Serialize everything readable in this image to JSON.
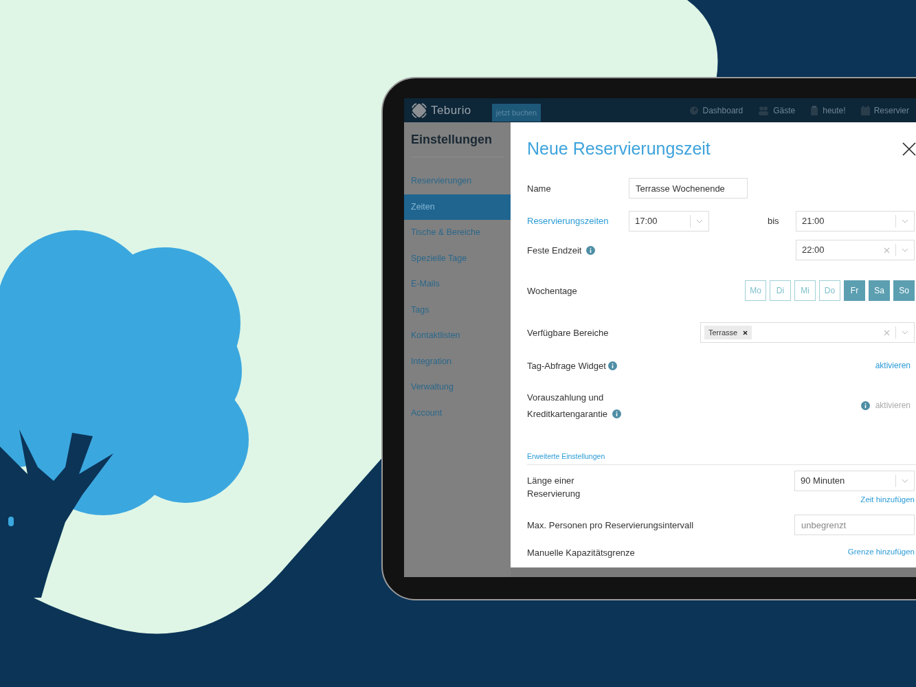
{
  "app_header": {
    "logo": "Teburio",
    "book_button": "jetzt buchen",
    "nav": [
      {
        "kind": "gauge",
        "label": "Dashboard"
      },
      {
        "kind": "people",
        "label": "Gäste"
      },
      {
        "kind": "clipboard",
        "label": "heute!"
      },
      {
        "kind": "calendar",
        "label": "Reservier"
      }
    ]
  },
  "sidebar": {
    "title": "Einstellungen",
    "items": [
      {
        "label": "Reservierungen",
        "selected": false
      },
      {
        "label": "Zeiten",
        "selected": true
      },
      {
        "label": "Tische & Bereiche",
        "selected": false
      },
      {
        "label": "Spezielle Tage",
        "selected": false
      },
      {
        "label": "E-Mails",
        "selected": false
      },
      {
        "label": "Tags",
        "selected": false
      },
      {
        "label": "Kontaktlisten",
        "selected": false
      },
      {
        "label": "Integration",
        "selected": false
      },
      {
        "label": "Verwaltung",
        "selected": false
      },
      {
        "label": "Account",
        "selected": false
      }
    ]
  },
  "modal": {
    "title": "Neue Reservierungszeit",
    "name": {
      "label": "Name",
      "value": "Terrasse Wochenende"
    },
    "times": {
      "label": "Reservierungszeiten",
      "from": "17:00",
      "separator": "bis",
      "to": "21:00"
    },
    "fixed_end": {
      "label": "Feste Endzeit",
      "value": "22:00"
    },
    "weekdays": {
      "label": "Wochentage",
      "days": [
        {
          "label": "Mo",
          "selected": false
        },
        {
          "label": "Di",
          "selected": false
        },
        {
          "label": "Mi",
          "selected": false
        },
        {
          "label": "Do",
          "selected": false
        },
        {
          "label": "Fr",
          "selected": true
        },
        {
          "label": "Sa",
          "selected": true
        },
        {
          "label": "So",
          "selected": true
        }
      ]
    },
    "areas": {
      "label": "Verfügbare Bereiche",
      "tags": [
        "Terrasse"
      ]
    },
    "widget": {
      "label": "Tag-Abfrage Widget",
      "action": "aktivieren",
      "disabled": false
    },
    "prepayment": {
      "label": "Vorauszahlung und Kreditkartengarantie",
      "action": "aktivieren",
      "disabled": true
    },
    "advanced_section": "Erweiterte Einstellungen",
    "duration": {
      "label": "Länge einer Reservierung",
      "value": "90 Minuten",
      "link": "Zeit hinzufügen"
    },
    "max_persons": {
      "label": "Max. Personen pro Reservierungsintervall",
      "placeholder": "unbegrenzt"
    },
    "capacity": {
      "label": "Manuelle Kapazitätsgrenze",
      "link": "Grenze hinzufügen"
    }
  }
}
